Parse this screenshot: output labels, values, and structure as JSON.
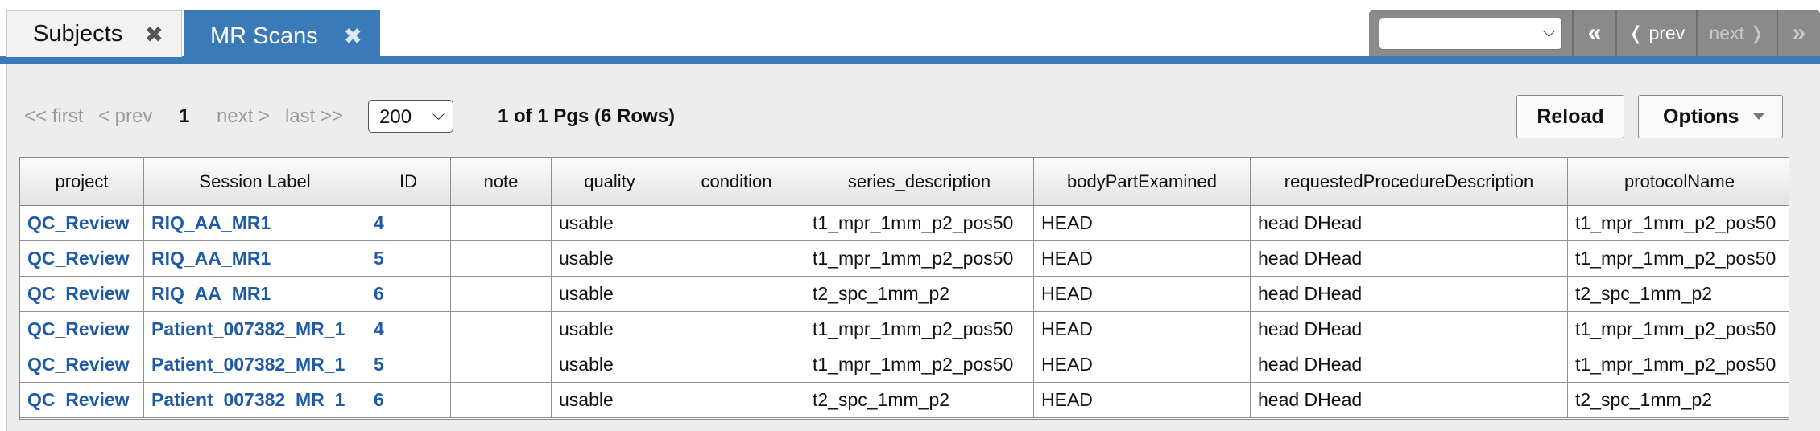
{
  "tabs": [
    {
      "label": "Subjects",
      "active": false
    },
    {
      "label": "MR Scans",
      "active": true
    }
  ],
  "tab_close_glyph": "✖",
  "record_nav": {
    "selected": "",
    "first": "«",
    "prev": "❬ prev",
    "next": "next ❭",
    "last": "»"
  },
  "pager": {
    "first": "<< first",
    "prev": "< prev",
    "current": "1",
    "next": "next >",
    "last": "last >>",
    "page_size": "200",
    "count_text": "1 of 1 Pgs (6 Rows)"
  },
  "buttons": {
    "reload": "Reload",
    "options": "Options"
  },
  "colors": {
    "accent": "#3a7ab8",
    "link": "#1f5aa6"
  },
  "table": {
    "columns": [
      "project",
      "Session Label",
      "ID",
      "note",
      "quality",
      "condition",
      "series_description",
      "bodyPartExamined",
      "requestedProcedureDescription",
      "protocolName"
    ],
    "rows": [
      [
        "QC_Review",
        "RIQ_AA_MR1",
        "4",
        "",
        "usable",
        "",
        "t1_mpr_1mm_p2_pos50",
        "HEAD",
        "head DHead",
        "t1_mpr_1mm_p2_pos50"
      ],
      [
        "QC_Review",
        "RIQ_AA_MR1",
        "5",
        "",
        "usable",
        "",
        "t1_mpr_1mm_p2_pos50",
        "HEAD",
        "head DHead",
        "t1_mpr_1mm_p2_pos50"
      ],
      [
        "QC_Review",
        "RIQ_AA_MR1",
        "6",
        "",
        "usable",
        "",
        "t2_spc_1mm_p2",
        "HEAD",
        "head DHead",
        "t2_spc_1mm_p2"
      ],
      [
        "QC_Review",
        "Patient_007382_MR_1",
        "4",
        "",
        "usable",
        "",
        "t1_mpr_1mm_p2_pos50",
        "HEAD",
        "head DHead",
        "t1_mpr_1mm_p2_pos50"
      ],
      [
        "QC_Review",
        "Patient_007382_MR_1",
        "5",
        "",
        "usable",
        "",
        "t1_mpr_1mm_p2_pos50",
        "HEAD",
        "head DHead",
        "t1_mpr_1mm_p2_pos50"
      ],
      [
        "QC_Review",
        "Patient_007382_MR_1",
        "6",
        "",
        "usable",
        "",
        "t2_spc_1mm_p2",
        "HEAD",
        "head DHead",
        "t2_spc_1mm_p2"
      ]
    ]
  }
}
